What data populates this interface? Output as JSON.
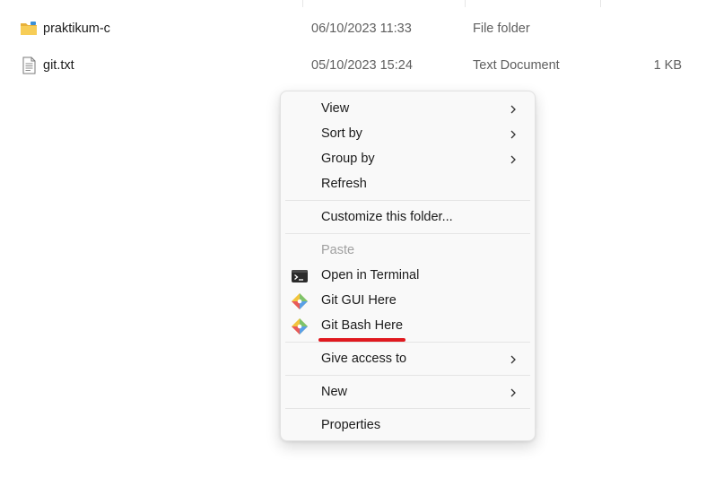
{
  "files": [
    {
      "name": "praktikum-c",
      "date": "06/10/2023 11:33",
      "type": "File folder",
      "size": "",
      "icon": "folder-icon"
    },
    {
      "name": "git.txt",
      "date": "05/10/2023 15:24",
      "type": "Text Document",
      "size": "1 KB",
      "icon": "text-file-icon"
    }
  ],
  "context_menu": {
    "items": {
      "view": "View",
      "sort_by": "Sort by",
      "group_by": "Group by",
      "refresh": "Refresh",
      "customize": "Customize this folder...",
      "paste": "Paste",
      "open_terminal": "Open in Terminal",
      "git_gui": "Git GUI Here",
      "git_bash": "Git Bash Here",
      "give_access": "Give access to",
      "new": "New",
      "properties": "Properties"
    },
    "highlight_color": "#e0191f"
  }
}
